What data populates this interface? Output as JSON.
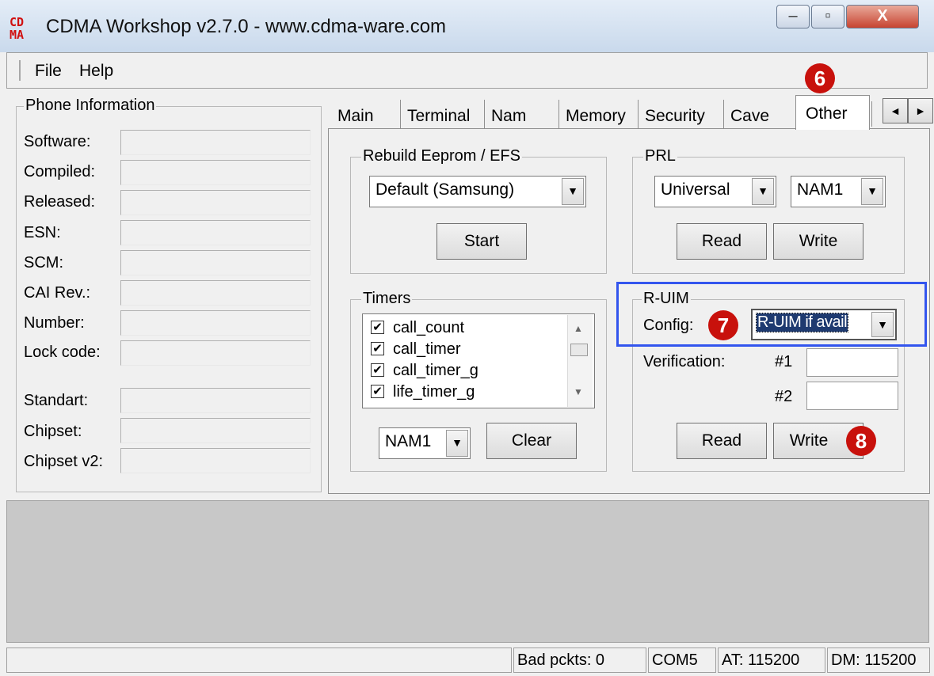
{
  "window": {
    "title": "CDMA Workshop v2.7.0  -  www.cdma-ware.com",
    "icon": "cdma-logo-icon",
    "caption_buttons": [
      "minimize-icon",
      "maximize-icon",
      "close-icon"
    ],
    "close_glyph": "X"
  },
  "menu": {
    "items": [
      "File",
      "Help"
    ]
  },
  "phone_info": {
    "title": "Phone Information",
    "fields": [
      "Software:",
      "Compiled:",
      "Released:",
      "ESN:",
      "SCM:",
      "CAI Rev.:",
      "Number:",
      "Lock code:",
      "Standart:",
      "Chipset:",
      "Chipset v2:"
    ]
  },
  "tabs": {
    "items": [
      "Main",
      "Terminal",
      "Nam",
      "Memory",
      "Security",
      "Cave",
      "Other"
    ],
    "active": "Other",
    "scroll_left": "◄",
    "scroll_right": "►"
  },
  "rebuild": {
    "title": "Rebuild Eeprom / EFS",
    "selected": "Default (Samsung)",
    "start_label": "Start"
  },
  "prl": {
    "title": "PRL",
    "type_selected": "Universal",
    "nam_selected": "NAM1",
    "read_label": "Read",
    "write_label": "Write"
  },
  "timers": {
    "title": "Timers",
    "items": [
      {
        "label": "call_count",
        "checked": true
      },
      {
        "label": "call_timer",
        "checked": true
      },
      {
        "label": "call_timer_g",
        "checked": true
      },
      {
        "label": "life_timer_g",
        "checked": true
      }
    ],
    "check_glyph": "✔",
    "nam_selected": "NAM1",
    "clear_label": "Clear"
  },
  "ruim": {
    "title": "R-UIM",
    "config_label": "Config:",
    "config_selected": "R-UIM if avail",
    "verification_label": "Verification:",
    "v1_label": "#1",
    "v2_label": "#2",
    "read_label": "Read",
    "write_label": "Write"
  },
  "annotations": {
    "tab_other": "6",
    "config": "7",
    "write": "8",
    "highlight_color": "#3355ee",
    "badge_color": "#c8110c"
  },
  "status": {
    "bad_packets": "Bad pckts: 0",
    "port": "COM5",
    "at_baud": "AT: 115200",
    "dm_baud": "DM: 115200"
  }
}
